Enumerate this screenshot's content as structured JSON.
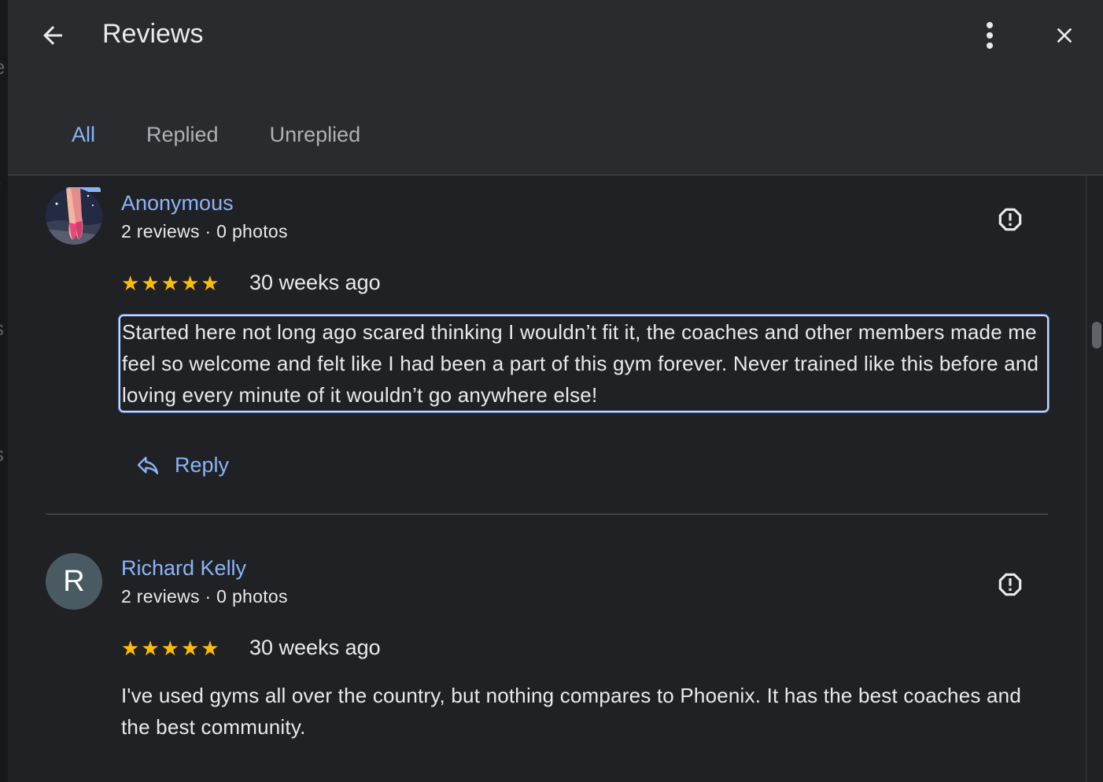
{
  "header": {
    "title": "Reviews",
    "back_icon": "arrow-back-icon",
    "more_icon": "more-vert-icon",
    "close_icon": "close-icon"
  },
  "tabs": [
    {
      "label": "All",
      "active": true
    },
    {
      "label": "Replied",
      "active": false
    },
    {
      "label": "Unreplied",
      "active": false
    }
  ],
  "colors": {
    "accent": "#8ab4f8",
    "star": "#fbbc04",
    "background": "#202124",
    "header_bg": "#2a2b2e",
    "text": "#e8eaed"
  },
  "reviews": [
    {
      "author": "Anonymous",
      "meta": "2 reviews · 0 photos",
      "rating": 5,
      "date": "30 weeks ago",
      "text": "Started here not long ago scared thinking I wouldn’t fit it, the coaches and other members made me feel so welcome and felt like I had been a part of this gym forever. Never trained like this before and loving every minute of it wouldn’t go anywhere else!",
      "avatar_icon": "ballet-shoes-avatar",
      "reply_label": "Reply"
    },
    {
      "author": "Richard Kelly",
      "meta": "2 reviews · 0 photos",
      "rating": 5,
      "date": "30 weeks ago",
      "text": "I've used gyms all over the country, but nothing compares to Phoenix. It has the best coaches and the best community.",
      "avatar_letter": "R"
    }
  ]
}
